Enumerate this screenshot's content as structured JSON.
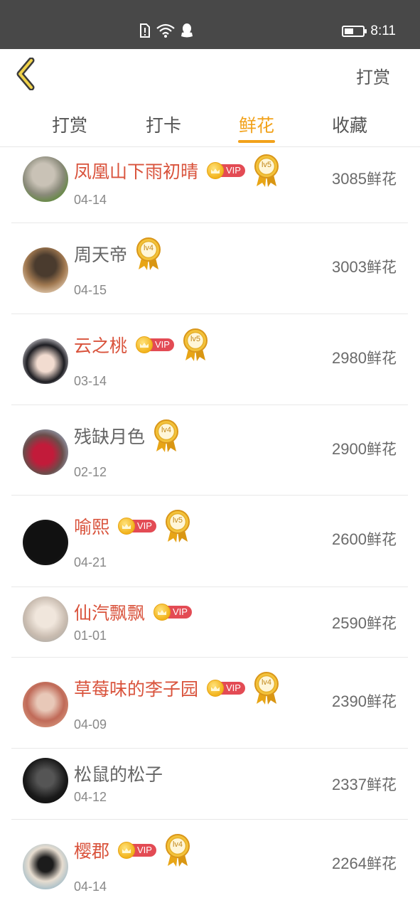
{
  "status_bar": {
    "time": "8:11",
    "battery_level": 0.5,
    "icons": [
      "sim-alert-icon",
      "wifi-icon",
      "qq-icon",
      "battery-icon"
    ]
  },
  "nav": {
    "back_icon": "chevron-left-icon",
    "action_label": "打赏"
  },
  "tabs": [
    {
      "label": "打赏",
      "active": false
    },
    {
      "label": "打卡",
      "active": false
    },
    {
      "label": "鲜花",
      "active": true
    },
    {
      "label": "收藏",
      "active": false
    }
  ],
  "colors": {
    "accent": "#f2a21b",
    "vip_name": "#d9533c",
    "vip_tag": "#e34b54",
    "status_bar": "#484848"
  },
  "entries": [
    {
      "name": "凤凰山下雨初晴",
      "vip": true,
      "vip_label": "VIP",
      "level": "lv5",
      "date": "04-14",
      "amount": "3085",
      "unit": "鲜花"
    },
    {
      "name": "周天帝",
      "vip": false,
      "level": "lv4",
      "date": "04-15",
      "amount": "3003",
      "unit": "鲜花"
    },
    {
      "name": "云之桃",
      "vip": true,
      "vip_label": "VIP",
      "level": "lv5",
      "date": "03-14",
      "amount": "2980",
      "unit": "鲜花"
    },
    {
      "name": "残缺月色",
      "vip": false,
      "level": "lv4",
      "date": "02-12",
      "amount": "2900",
      "unit": "鲜花"
    },
    {
      "name": "喻熙",
      "vip": true,
      "vip_label": "VIP",
      "level": "lv5",
      "date": "04-21",
      "amount": "2600",
      "unit": "鲜花"
    },
    {
      "name": "仙汽飘飘",
      "vip": true,
      "vip_label": "VIP",
      "level": "",
      "date": "01-01",
      "amount": "2590",
      "unit": "鲜花"
    },
    {
      "name": "草莓味的李子园",
      "vip": true,
      "vip_label": "VIP",
      "level": "lv4",
      "date": "04-09",
      "amount": "2390",
      "unit": "鲜花"
    },
    {
      "name": "松鼠的松子",
      "vip": false,
      "level": "",
      "date": "04-12",
      "amount": "2337",
      "unit": "鲜花"
    },
    {
      "name": "樱郡",
      "vip": true,
      "vip_label": "VIP",
      "level": "lv4",
      "date": "04-14",
      "amount": "2264",
      "unit": "鲜花"
    }
  ]
}
